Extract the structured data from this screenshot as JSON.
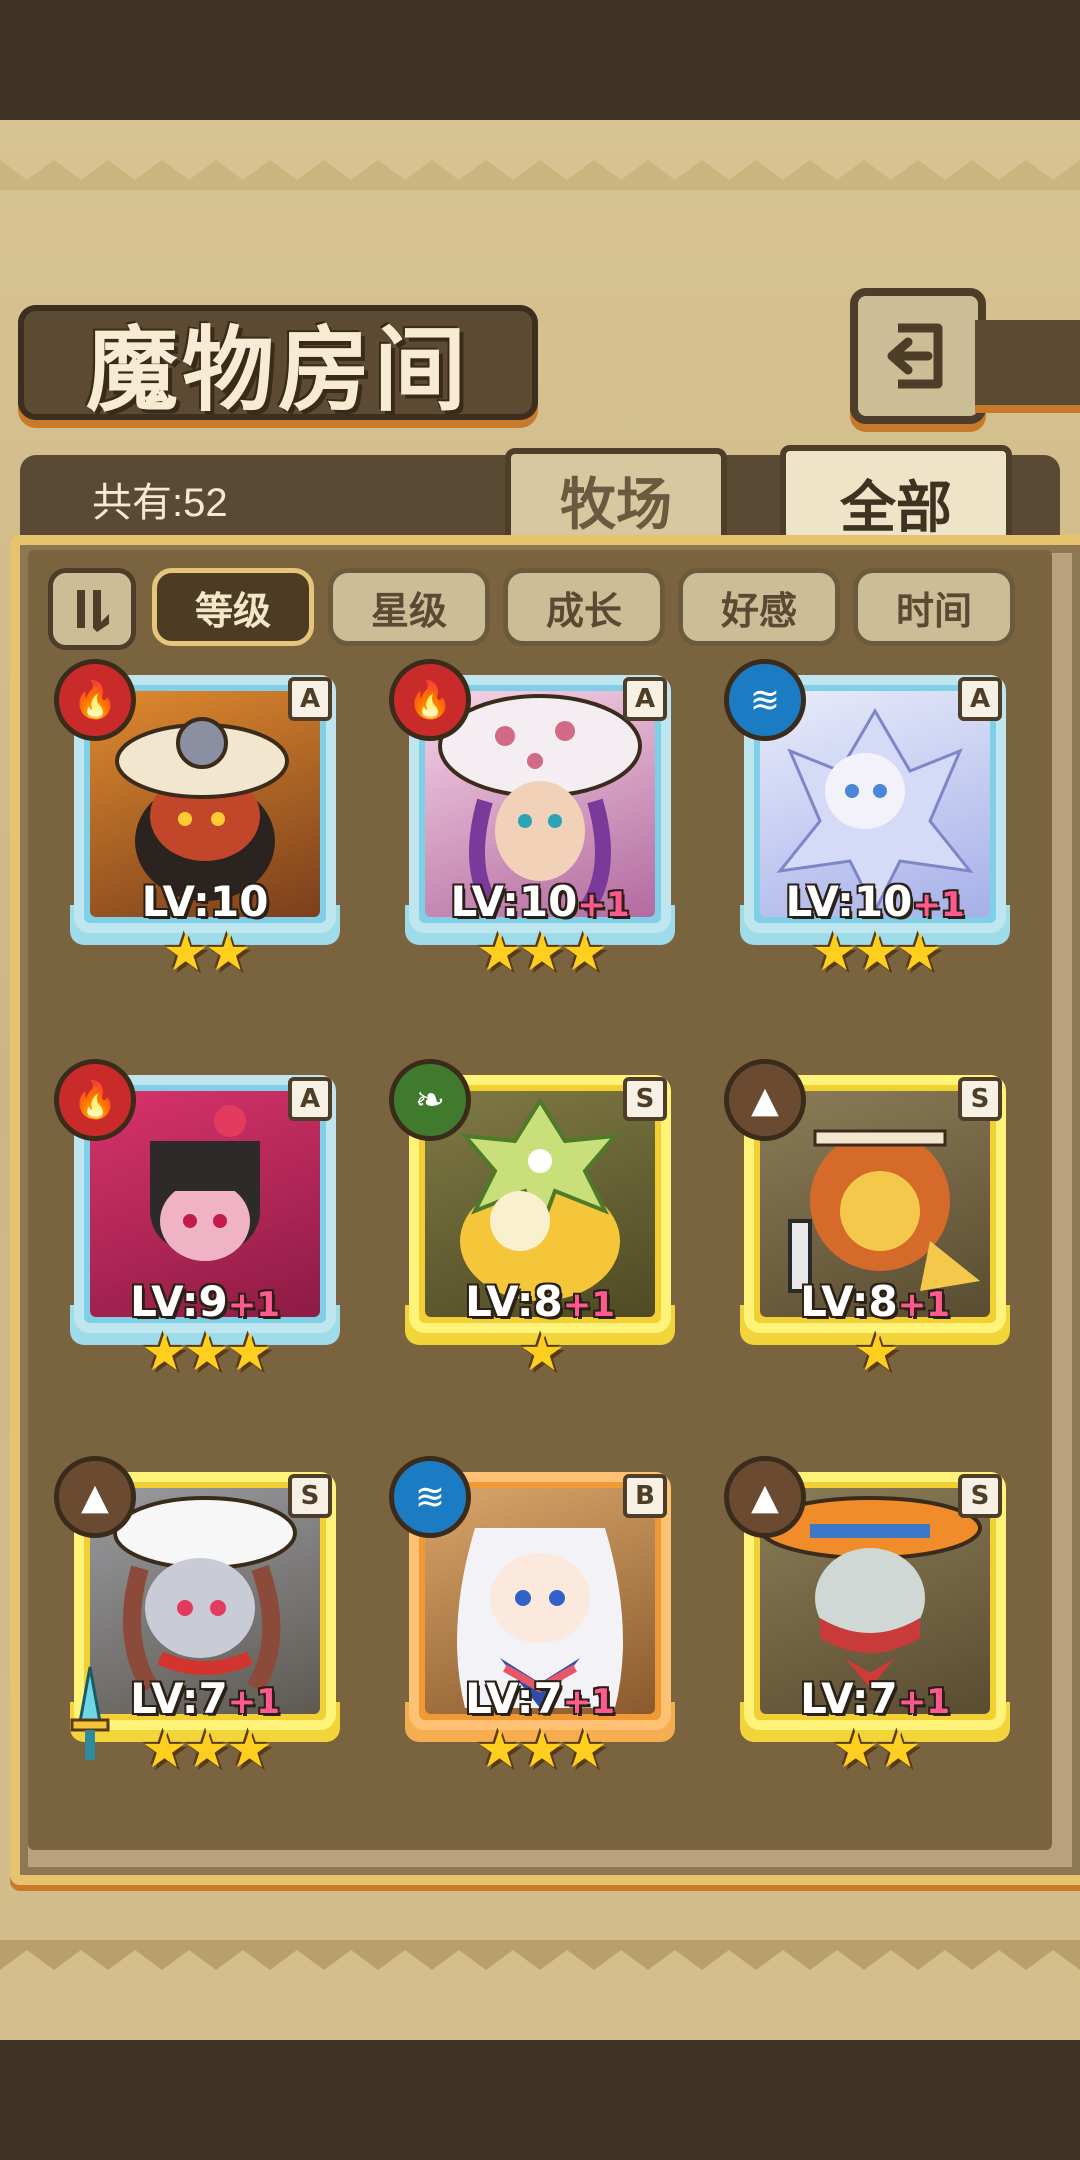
{
  "header": {
    "title": "魔物房间"
  },
  "summary": {
    "count_label": "共有:52"
  },
  "tabs": [
    {
      "label": "牧场"
    },
    {
      "label": "全部"
    }
  ],
  "filters": [
    {
      "label": "等级",
      "active": true
    },
    {
      "label": "星级",
      "active": false
    },
    {
      "label": "成长",
      "active": false
    },
    {
      "label": "好感",
      "active": false
    },
    {
      "label": "时间",
      "active": false
    }
  ],
  "monsters": [
    {
      "element": "fire",
      "rank": "A",
      "level": "LV:10",
      "plus": "",
      "stars": "★★",
      "frame": "blue"
    },
    {
      "element": "fire",
      "rank": "A",
      "level": "LV:10",
      "plus": "+1",
      "stars": "★★★",
      "frame": "blue"
    },
    {
      "element": "water",
      "rank": "A",
      "level": "LV:10",
      "plus": "+1",
      "stars": "★★★",
      "frame": "blue"
    },
    {
      "element": "fire",
      "rank": "A",
      "level": "LV:9",
      "plus": "+1",
      "stars": "★★★",
      "frame": "blue"
    },
    {
      "element": "grass",
      "rank": "S",
      "level": "LV:8",
      "plus": "+1",
      "stars": "★",
      "frame": "gold"
    },
    {
      "element": "earth",
      "rank": "S",
      "level": "LV:8",
      "plus": "+1",
      "stars": "★",
      "frame": "gold"
    },
    {
      "element": "earth",
      "rank": "S",
      "level": "LV:7",
      "plus": "+1",
      "stars": "★★★",
      "frame": "gold"
    },
    {
      "element": "water",
      "rank": "B",
      "level": "LV:7",
      "plus": "+1",
      "stars": "★★★",
      "frame": "orange"
    },
    {
      "element": "earth",
      "rank": "S",
      "level": "LV:7",
      "plus": "+1",
      "stars": "★★",
      "frame": "gold"
    }
  ],
  "icons": {
    "back": "back-arrow-icon",
    "sort": "sort-order-icon",
    "fire": "fire-icon",
    "water": "water-icon",
    "grass": "leaf-icon",
    "earth": "mountain-icon",
    "sword": "sword-icon"
  },
  "colors": {
    "accent_orange": "#c87a2c",
    "panel_brown": "#7a6440",
    "parchment": "#d4bf8c"
  }
}
